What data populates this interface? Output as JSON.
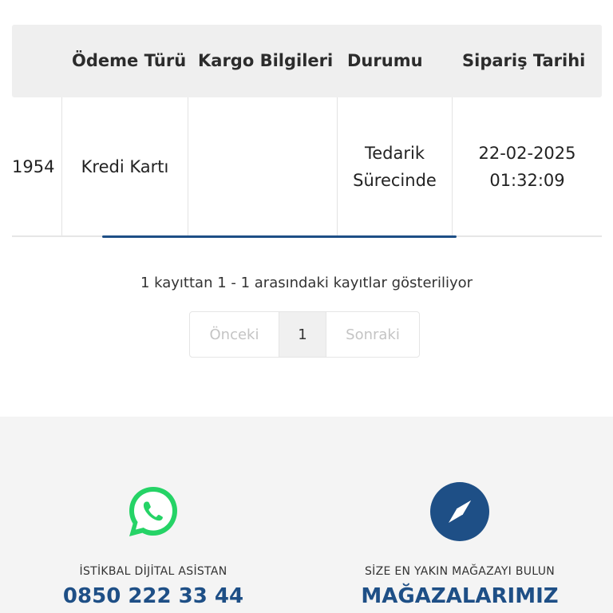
{
  "table": {
    "headers": [
      "",
      "Ödeme Türü",
      "Kargo Bilgileri",
      "Durumu",
      "Sipariş Tarihi"
    ],
    "rows": [
      {
        "order_no": "1954",
        "payment": "Kredi Kartı",
        "cargo": "",
        "status": "Tedarik Sürecinde",
        "date": "22-02-2025 01:32:09"
      }
    ]
  },
  "pagination": {
    "info": "1 kayıttan 1 - 1 arasındaki kayıtlar gösteriliyor",
    "prev": "Önceki",
    "current": "1",
    "next": "Sonraki"
  },
  "footer": {
    "whatsapp": {
      "icon": "whatsapp-icon",
      "label": "İSTİKBAL DİJİTAL ASİSTAN",
      "value": "0850 222 33 44",
      "color": "#25D366"
    },
    "stores": {
      "icon": "compass-icon",
      "label": "SİZE EN YAKIN MAĞAZAYI BULUN",
      "value": "MAĞAZALARIMIZ",
      "color": "#1e4f86"
    }
  },
  "colors": {
    "accent": "#1e4f86",
    "header_bg": "#efefef",
    "footer_bg": "#f4f4f4"
  }
}
